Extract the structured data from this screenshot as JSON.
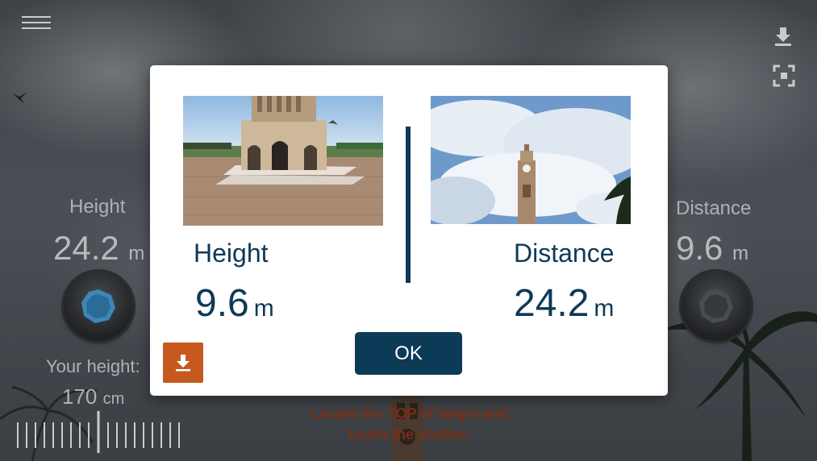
{
  "background": {
    "height_label": "Height",
    "height_value": "24.2",
    "height_unit": "m",
    "distance_label": "Distance",
    "distance_value": "9.6",
    "distance_unit": "m",
    "your_height_label": "Your height:",
    "your_height_value": "170",
    "your_height_unit": "cm",
    "hint_line1": "Locate the TOP of target and",
    "hint_line2": "touch the shutter."
  },
  "dialog": {
    "height_label": "Height",
    "height_value": "9.6",
    "height_unit": "m",
    "distance_label": "Distance",
    "distance_value": "24.2",
    "distance_unit": "m",
    "ok_label": "OK"
  },
  "colors": {
    "accent": "#0d3a57",
    "save_button": "#c65a1e",
    "hint_text": "#7a2f14"
  }
}
